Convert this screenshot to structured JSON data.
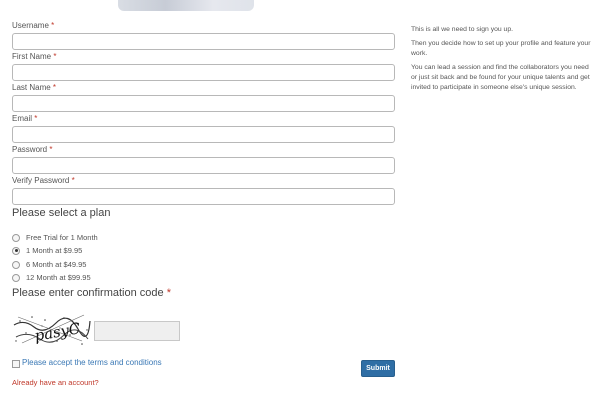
{
  "form": {
    "fields": [
      {
        "label": "Username",
        "required": "*",
        "value": ""
      },
      {
        "label": "First Name",
        "required": "*",
        "value": ""
      },
      {
        "label": "Last Name",
        "required": "*",
        "value": ""
      },
      {
        "label": "Email",
        "required": "*",
        "value": ""
      },
      {
        "label": "Password",
        "required": "*",
        "value": ""
      },
      {
        "label": "Verify Password",
        "required": "*",
        "value": ""
      }
    ],
    "plan_title": "Please select a plan",
    "plans": [
      {
        "label": "Free Trial for 1 Month",
        "selected": false
      },
      {
        "label": "1 Month at $9.95",
        "selected": true
      },
      {
        "label": "6 Month at $49.95",
        "selected": false
      },
      {
        "label": "12 Month at $99.95",
        "selected": false
      }
    ],
    "confirmation_title": "Please enter confirmation code",
    "confirmation_required": "*",
    "captcha_text": "pasyC",
    "captcha_value": "",
    "terms_label": "Please accept the terms and conditions",
    "terms_checked": false,
    "submit_label": "Submit",
    "account_link": "Already have an account?"
  },
  "side": {
    "paragraphs": [
      "This is all we need to sign you up.",
      "Then you decide how to set up your profile and feature your work.",
      "You can lead a session and find the collaborators you need or just sit back and be found for your unique talents and get invited to participate in someone else's unique session."
    ]
  },
  "colors": {
    "accent": "#2f6ea5",
    "link": "#3a78b5",
    "required": "#c0392b"
  }
}
